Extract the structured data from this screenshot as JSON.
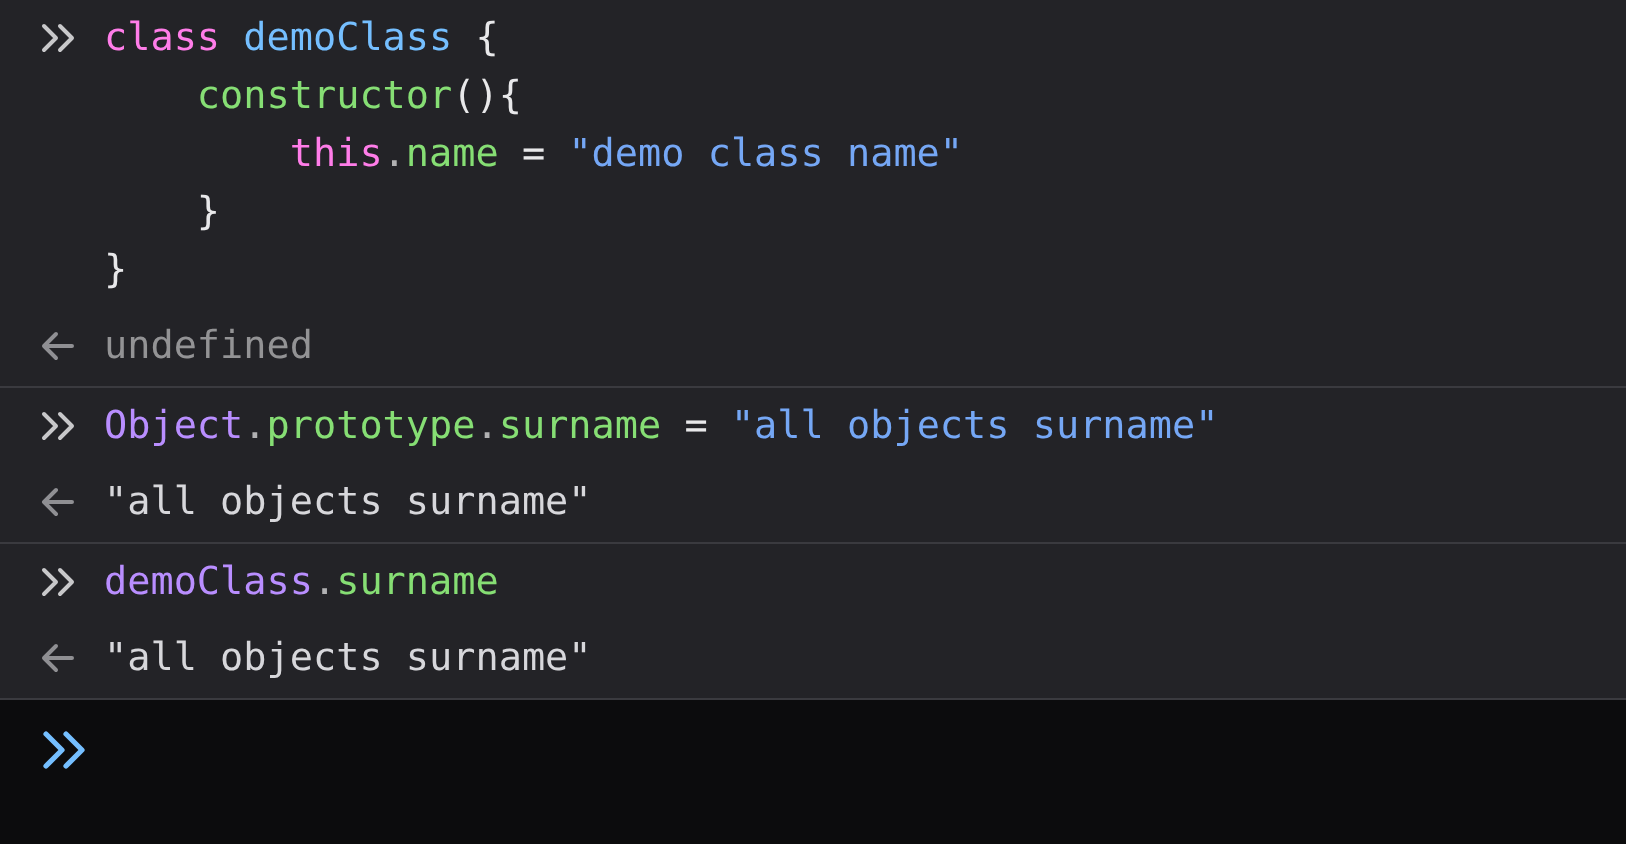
{
  "console": {
    "entries": [
      {
        "kind": "input",
        "lines": [
          [
            {
              "text": "class ",
              "color": "#ff7de9"
            },
            {
              "text": "demoClass",
              "color": "#75bfff"
            },
            {
              "text": " {",
              "color": "#e8e8ea"
            }
          ],
          [
            {
              "text": "    constructor",
              "color": "#86de74"
            },
            {
              "text": "(){",
              "color": "#e8e8ea"
            }
          ],
          [
            {
              "text": "        this",
              "color": "#ff7de9"
            },
            {
              "text": ".",
              "color": "#b1b1b3"
            },
            {
              "text": "name",
              "color": "#86de74"
            },
            {
              "text": " = ",
              "color": "#e8e8ea"
            },
            {
              "text": "\"demo class name\"",
              "color": "#75a7f5"
            }
          ],
          [
            {
              "text": "    }",
              "color": "#e8e8ea"
            }
          ],
          [
            {
              "text": "}",
              "color": "#e8e8ea"
            }
          ]
        ]
      },
      {
        "kind": "output",
        "text": "undefined",
        "color": "#939395"
      },
      {
        "kind": "input",
        "lines": [
          [
            {
              "text": "Object",
              "color": "#b98eff"
            },
            {
              "text": ".",
              "color": "#b1b1b3"
            },
            {
              "text": "prototype",
              "color": "#86de74"
            },
            {
              "text": ".",
              "color": "#b1b1b3"
            },
            {
              "text": "surname",
              "color": "#86de74"
            },
            {
              "text": " = ",
              "color": "#e8e8ea"
            },
            {
              "text": "\"all objects surname\"",
              "color": "#75a7f5"
            }
          ]
        ]
      },
      {
        "kind": "output",
        "text": "\"all objects surname\"",
        "color": "#d7d7db"
      },
      {
        "kind": "input",
        "lines": [
          [
            {
              "text": "demoClass",
              "color": "#b98eff"
            },
            {
              "text": ".",
              "color": "#b1b1b3"
            },
            {
              "text": "surname",
              "color": "#86de74"
            }
          ]
        ]
      },
      {
        "kind": "output",
        "text": "\"all objects surname\"",
        "color": "#d7d7db"
      }
    ]
  }
}
